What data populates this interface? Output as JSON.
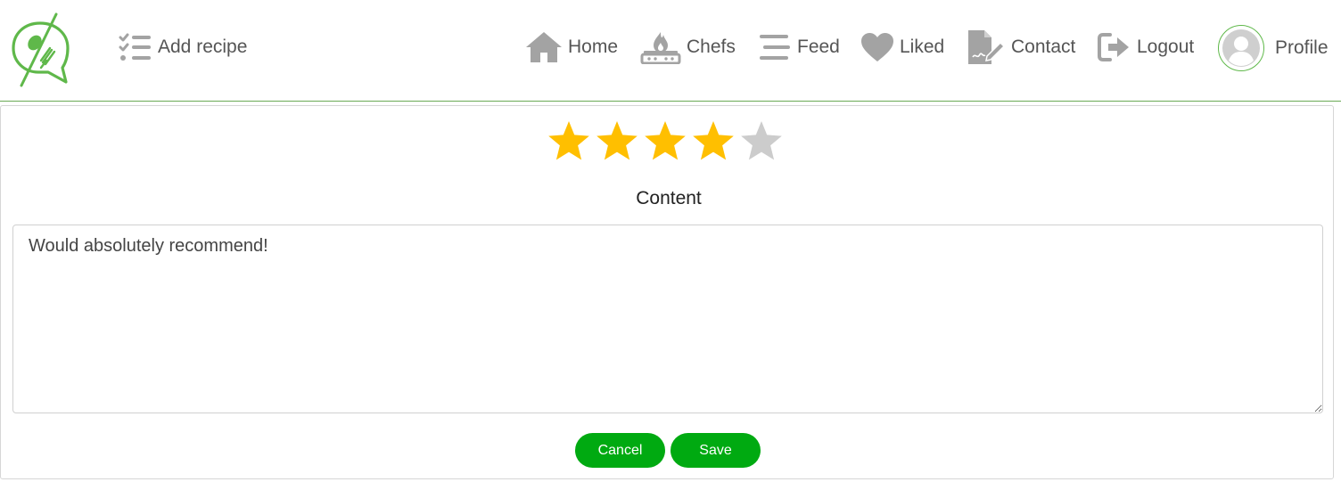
{
  "header": {
    "logo_icon": "chat-bubble-spoon-fork-logo-icon",
    "add_recipe": {
      "label": "Add recipe",
      "icon": "checklist-icon"
    },
    "nav": [
      {
        "key": "home",
        "label": "Home",
        "icon": "home-icon"
      },
      {
        "key": "chefs",
        "label": "Chefs",
        "icon": "stove-flame-icon"
      },
      {
        "key": "feed",
        "label": "Feed",
        "icon": "lines-icon"
      },
      {
        "key": "liked",
        "label": "Liked",
        "icon": "heart-icon"
      },
      {
        "key": "contact",
        "label": "Contact",
        "icon": "document-pen-icon"
      },
      {
        "key": "logout",
        "label": "Logout",
        "icon": "sign-out-icon"
      },
      {
        "key": "profile",
        "label": "Profile",
        "icon": "user-avatar-icon"
      }
    ]
  },
  "review": {
    "rating": 4,
    "max_rating": 5,
    "content_label": "Content",
    "content_value": "Would absolutely recommend!"
  },
  "actions": {
    "cancel_label": "Cancel",
    "save_label": "Save"
  },
  "colors": {
    "brand_green": "#5fb84a",
    "button_green": "#00aa11",
    "star_filled": "#ffbf00",
    "star_empty": "#cccccc",
    "icon_gray": "#a3a3a3"
  }
}
